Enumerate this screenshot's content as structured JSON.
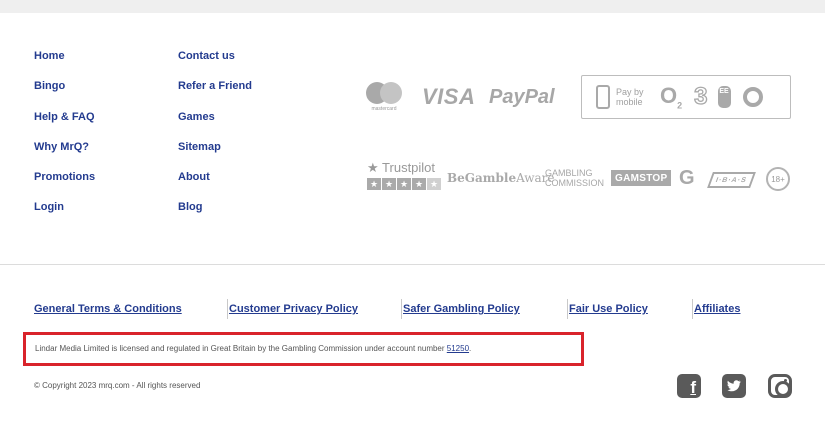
{
  "nav": {
    "col1": [
      "Home",
      "Bingo",
      "Help & FAQ",
      "Why MrQ?",
      "Promotions",
      "Login"
    ],
    "col2": [
      "Contact us",
      "Refer a Friend",
      "Games",
      "Sitemap",
      "About",
      "Blog"
    ]
  },
  "payments": {
    "mastercard": "mastercard",
    "visa": "VISA",
    "paypal": "PayPal",
    "pay_by_mobile": "Pay by mobile",
    "o2": "O",
    "o2_sub": "2",
    "three": "3",
    "ee": "EE"
  },
  "responsible": {
    "trustpilot": "Trustpilot",
    "begambleaware_a": "BeGamble",
    "begambleaware_b": "Aware",
    "gambling": "GAMBLING",
    "commission": "COMMISSION",
    "gamstop": "GAMSTOP",
    "gamcare": "G",
    "ibas": "I·B·A·S",
    "age": "18+"
  },
  "policies": [
    "General Terms & Conditions",
    "Customer Privacy Policy",
    "Safer Gambling Policy",
    "Fair Use Policy",
    "Affiliates"
  ],
  "license": {
    "text": "Lindar Media Limited is licensed and regulated in Great Britain by the Gambling Commission under account number ",
    "number": "51250",
    "end": "."
  },
  "copyright": "© Copyright 2023 mrq.com - All rights reserved",
  "social": {
    "facebook": "f"
  },
  "colors": {
    "link": "#233b8f",
    "highlight_border": "#d9232b",
    "logo_grey": "#a9a9a9"
  }
}
